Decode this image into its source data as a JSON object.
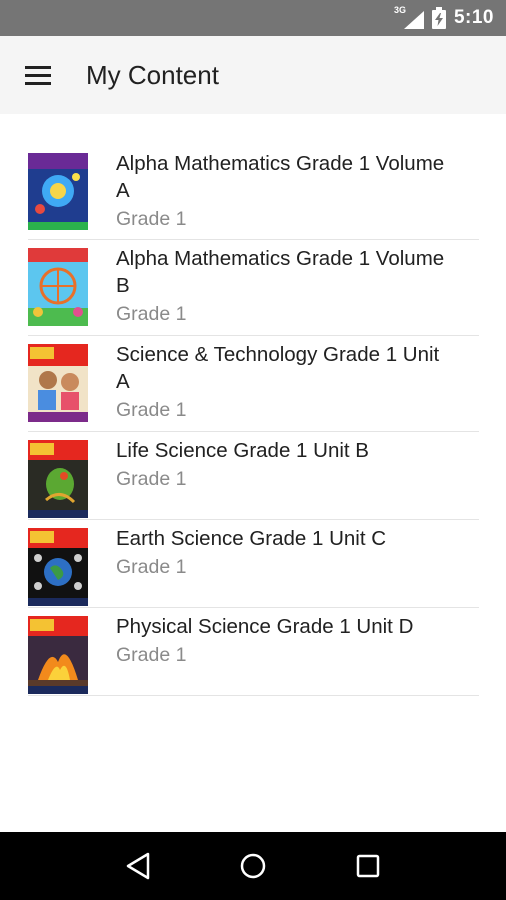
{
  "status_bar": {
    "network": "3G",
    "time": "5:10",
    "icons": [
      "signal-icon",
      "battery-icon"
    ]
  },
  "app_bar": {
    "title": "My Content",
    "menu_icon": "hamburger-menu-icon"
  },
  "items": [
    {
      "title_line1": "Alpha Mathematics Grade 1 Volume",
      "title_line2": "A",
      "subtitle": "Grade 1",
      "cover": "math-cover-a"
    },
    {
      "title_line1": "Alpha Mathematics Grade 1 Volume",
      "title_line2": "B",
      "subtitle": "Grade 1",
      "cover": "math-cover-b"
    },
    {
      "title_line1": "Science & Technology Grade 1 Unit",
      "title_line2": "A",
      "subtitle": "Grade 1",
      "cover": "science-cover-a"
    },
    {
      "title_line1": "Life Science Grade 1 Unit B",
      "title_line2": "",
      "subtitle": "Grade 1",
      "cover": "science-cover-b"
    },
    {
      "title_line1": "Earth Science Grade 1 Unit C",
      "title_line2": "",
      "subtitle": "Grade 1",
      "cover": "science-cover-c"
    },
    {
      "title_line1": "Physical Science Grade 1 Unit D",
      "title_line2": "",
      "subtitle": "Grade 1",
      "cover": "science-cover-d"
    }
  ],
  "nav_bar": {
    "icons": [
      "back-icon",
      "home-icon",
      "recents-icon"
    ]
  },
  "colors": {
    "status_bar": "#757575",
    "app_bar": "#f5f5f5",
    "nav_bar": "#000000",
    "subtitle_text": "#8a8a8a"
  }
}
